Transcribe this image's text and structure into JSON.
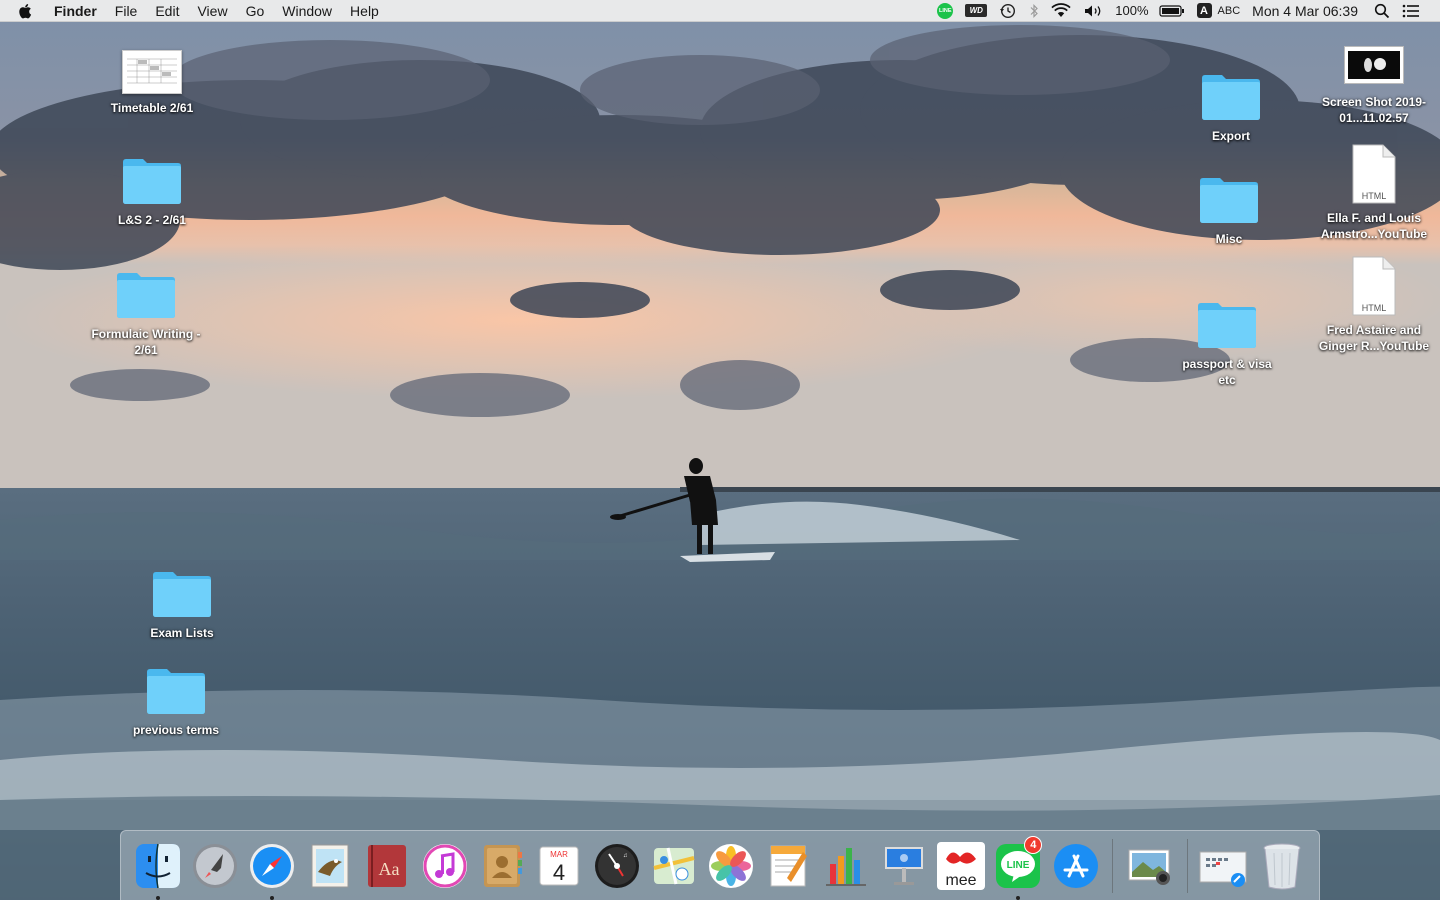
{
  "menubar": {
    "app_name": "Finder",
    "menus": [
      "File",
      "Edit",
      "View",
      "Go",
      "Window",
      "Help"
    ],
    "status": {
      "line_label": "LINE",
      "wd_label": "WD",
      "battery_percent": "100%",
      "input_letter": "A",
      "input_name": "ABC",
      "clock": "Mon 4 Mar  06:39"
    }
  },
  "desktop": {
    "left_items": [
      {
        "label": "Timetable 2/61",
        "kind": "thumbnail"
      },
      {
        "label": "L&S 2 - 2/61",
        "kind": "folder"
      },
      {
        "label": "Formulaic Writing - 2/61",
        "kind": "folder"
      },
      {
        "label": "Exam Lists",
        "kind": "folder"
      },
      {
        "label": "previous terms",
        "kind": "folder"
      }
    ],
    "right_items": [
      {
        "label": "Export",
        "kind": "folder"
      },
      {
        "label": "Misc",
        "kind": "folder"
      },
      {
        "label": "passport & visa etc",
        "kind": "folder"
      },
      {
        "label": "Screen Shot 2019-01...11.02.57",
        "kind": "screenshot"
      },
      {
        "label": "Ella F. and Louis Armstro...YouTube",
        "kind": "html",
        "doc_tag": "HTML"
      },
      {
        "label": "Fred Astaire and Ginger R...YouTube",
        "kind": "html",
        "doc_tag": "HTML"
      }
    ]
  },
  "dock": {
    "apps": [
      {
        "name": "finder-icon",
        "running": true
      },
      {
        "name": "launchpad-icon",
        "running": false
      },
      {
        "name": "safari-icon",
        "running": true
      },
      {
        "name": "preview-bird-icon",
        "running": false
      },
      {
        "name": "dictionary-icon",
        "running": false,
        "text": "Aa"
      },
      {
        "name": "itunes-icon",
        "running": false
      },
      {
        "name": "contacts-icon",
        "running": false
      },
      {
        "name": "calendar-icon",
        "running": false,
        "month": "MAR",
        "day": "4"
      },
      {
        "name": "dashboard-icon",
        "running": false
      },
      {
        "name": "maps-icon",
        "running": false
      },
      {
        "name": "photos-icon",
        "running": false
      },
      {
        "name": "pages-icon",
        "running": false
      },
      {
        "name": "numbers-icon",
        "running": false
      },
      {
        "name": "keynote-icon",
        "running": false
      },
      {
        "name": "mee-icon",
        "running": false,
        "text": "mee"
      },
      {
        "name": "line-icon",
        "running": true,
        "text": "LINE",
        "badge": "4"
      },
      {
        "name": "app-store-icon",
        "running": false
      }
    ],
    "right": [
      {
        "name": "image-capture-icon"
      },
      {
        "name": "downloads-stack-icon"
      },
      {
        "name": "trash-icon"
      }
    ]
  },
  "colors": {
    "folder_blue": "#5ac8f5",
    "menubar_bg": "#ececec",
    "badge_red": "#f03a2e",
    "line_green": "#1bc34a"
  }
}
